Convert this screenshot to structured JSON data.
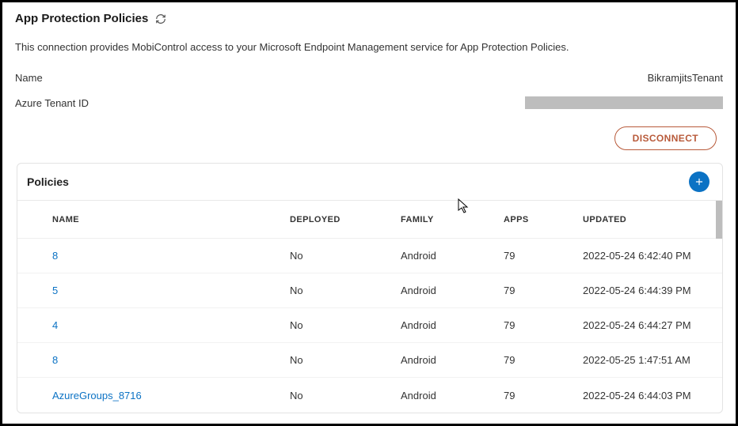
{
  "header": {
    "title": "App Protection Policies"
  },
  "description": "This connection provides MobiControl access to your Microsoft Endpoint Management service for App Protection Policies.",
  "fields": {
    "name_label": "Name",
    "name_value": "BikramjitsTenant",
    "tenant_label": "Azure Tenant ID"
  },
  "actions": {
    "disconnect": "DISCONNECT"
  },
  "policies": {
    "title": "Policies",
    "columns": {
      "name": "NAME",
      "deployed": "DEPLOYED",
      "family": "FAMILY",
      "apps": "APPS",
      "updated": "UPDATED"
    },
    "rows": [
      {
        "name": "8",
        "deployed": "No",
        "family": "Android",
        "apps": "79",
        "updated": "2022-05-24 6:42:40 PM"
      },
      {
        "name": "5",
        "deployed": "No",
        "family": "Android",
        "apps": "79",
        "updated": "2022-05-24 6:44:39 PM"
      },
      {
        "name": "4",
        "deployed": "No",
        "family": "Android",
        "apps": "79",
        "updated": "2022-05-24 6:44:27 PM"
      },
      {
        "name": "8",
        "deployed": "No",
        "family": "Android",
        "apps": "79",
        "updated": "2022-05-25 1:47:51 AM"
      },
      {
        "name": "AzureGroups_8716",
        "deployed": "No",
        "family": "Android",
        "apps": "79",
        "updated": "2022-05-24 6:44:03 PM"
      }
    ]
  }
}
